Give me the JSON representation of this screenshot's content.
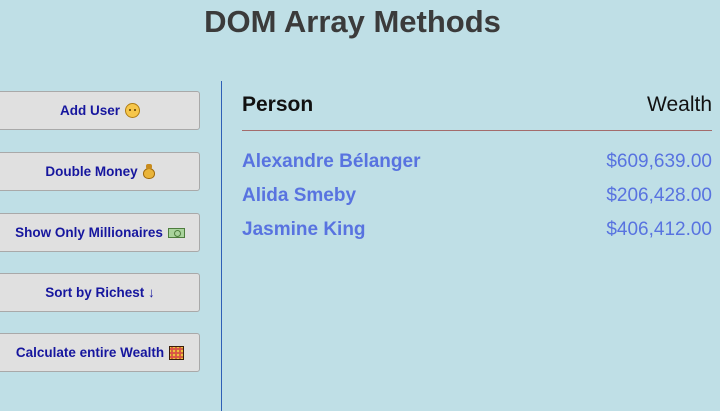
{
  "header": {
    "title": "DOM Array Methods"
  },
  "controls": {
    "buttons": [
      {
        "label": "Add User",
        "icon": "face-emoji-icon"
      },
      {
        "label": "Double Money",
        "icon": "money-bag-icon"
      },
      {
        "label": "Show Only Millionaires",
        "icon": "dollar-bill-icon"
      },
      {
        "label": "Sort by Richest ↓",
        "icon": ""
      },
      {
        "label": "Calculate entire Wealth",
        "icon": "abacus-icon"
      }
    ]
  },
  "table": {
    "headers": {
      "person": "Person",
      "wealth": "Wealth"
    },
    "rows": [
      {
        "name": "Alexandre Bélanger",
        "wealth": "$609,639.00"
      },
      {
        "name": "Alida Smeby",
        "wealth": "$206,428.00"
      },
      {
        "name": "Jasmine King",
        "wealth": "$406,412.00"
      }
    ]
  },
  "colors": {
    "background": "#bfdfe6",
    "button_text": "#16169e",
    "row_text": "#5873e0",
    "divider": "#2e5fb6",
    "header_rule": "#a36c6c"
  }
}
